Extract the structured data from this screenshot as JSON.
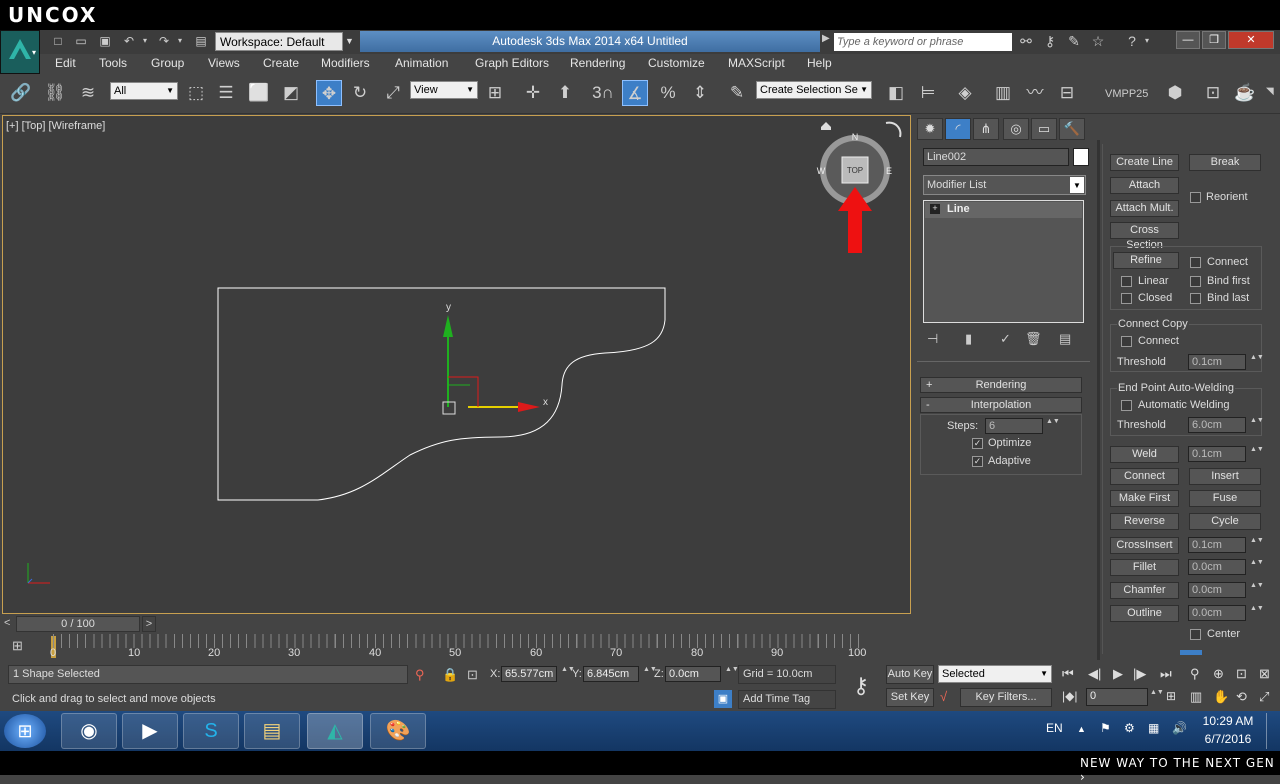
{
  "brand": {
    "top": "UNCOX",
    "bottom": "NEW WAY TO THE NEXT GEN ›"
  },
  "titlebar": {
    "workspace": "Workspace: Default",
    "title": "Autodesk 3ds Max  2014 x64      Untitled",
    "search_placeholder": "Type a keyword or phrase"
  },
  "menus": [
    "Edit",
    "Tools",
    "Group",
    "Views",
    "Create",
    "Modifiers",
    "Animation",
    "Graph Editors",
    "Rendering",
    "Customize",
    "MAXScript",
    "Help"
  ],
  "toolbar": {
    "filter": "All",
    "ref_coord": "View",
    "selection_set": "Create Selection Se",
    "vmpp": "VMPP25",
    "snap_num": "3"
  },
  "viewport": {
    "label": "[+] [Top] [Wireframe]",
    "viewcube": "TOP",
    "compass": {
      "n": "N",
      "s": "S",
      "e": "E",
      "w": "W"
    },
    "gizmo": {
      "x": "x",
      "y": "y"
    }
  },
  "panel": {
    "object_name": "Line002",
    "modifier_list": "Modifier List",
    "stack_item": "Line",
    "rendering": "Rendering",
    "interpolation": "Interpolation",
    "steps_label": "Steps:",
    "steps_value": "6",
    "optimize": "Optimize",
    "adaptive": "Adaptive",
    "create_line": "Create Line",
    "break": "Break",
    "attach": "Attach",
    "reorient": "Reorient",
    "attach_mult": "Attach Mult.",
    "cross_section": "Cross Section",
    "refine": "Refine",
    "connect": "Connect",
    "linear": "Linear",
    "bind_first": "Bind first",
    "closed": "Closed",
    "bind_last": "Bind last",
    "connect_copy": "Connect Copy",
    "cc_connect": "Connect",
    "threshold": "Threshold",
    "cc_threshold": "0.1cm",
    "endpoint_welding": "End Point Auto-Welding",
    "auto_welding": "Automatic Welding",
    "ew_threshold": "6.0cm",
    "weld": "Weld",
    "weld_val": "0.1cm",
    "connect_btn": "Connect",
    "insert": "Insert",
    "make_first": "Make First",
    "fuse": "Fuse",
    "reverse": "Reverse",
    "cycle": "Cycle",
    "crossinsert": "CrossInsert",
    "crossinsert_val": "0.1cm",
    "fillet": "Fillet",
    "fillet_val": "0.0cm",
    "chamfer": "Chamfer",
    "chamfer_val": "0.0cm",
    "outline": "Outline",
    "outline_val": "0.0cm",
    "center": "Center"
  },
  "timeline": {
    "frame": "0 / 100",
    "ticks": [
      "0",
      "10",
      "20",
      "30",
      "40",
      "50",
      "60",
      "70",
      "80",
      "90",
      "100"
    ]
  },
  "status": {
    "selected": "1 Shape Selected",
    "prompt": "Click and drag to select and move objects",
    "x_label": "X:",
    "x": "65.577cm",
    "y_label": "Y:",
    "y": "6.845cm",
    "z_label": "Z:",
    "z": "0.0cm",
    "grid": "Grid = 10.0cm",
    "add_time_tag": "Add Time Tag",
    "auto_key": "Auto Key",
    "set_key": "Set Key",
    "key_mode": "Selected",
    "key_filters": "Key Filters...",
    "frame_field": "0"
  },
  "taskbar": {
    "lang": "EN",
    "time": "10:29 AM",
    "date": "6/7/2016"
  }
}
